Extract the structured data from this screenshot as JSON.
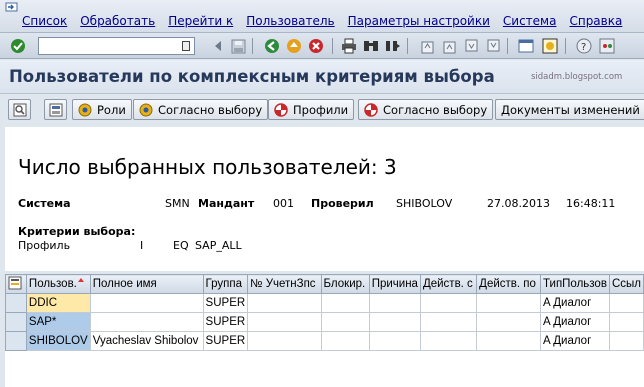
{
  "menu": {
    "items": [
      "Список",
      "Обработать",
      "Перейти к",
      "Пользователь",
      "Параметры настройки",
      "Система",
      "Справка"
    ]
  },
  "toolbar": {
    "command_value": "",
    "icons": [
      "enter-icon",
      "save-icon",
      "back-icon",
      "exit-icon",
      "cancel-icon",
      "print-icon",
      "find-icon",
      "find-next-icon",
      "first-page-icon",
      "prev-page-icon",
      "next-page-icon",
      "last-page-icon",
      "create-session-icon",
      "shortcut-icon",
      "help-icon",
      "customize-layout-icon"
    ]
  },
  "title": {
    "text": "Пользователи по комплексным критериям выбора",
    "watermark": "sidadm.blogspot.com"
  },
  "app_toolbar": {
    "roles_label": "Роли",
    "by_selection_label_1": "Согласно выбору",
    "profiles_label": "Профили",
    "by_selection_label_2": "Согласно выбору",
    "change_docs_label": "Документы изменений"
  },
  "report": {
    "heading": "Число выбранных пользователей: 3",
    "system_label": "Система",
    "system_value": "SMN",
    "client_label": "Мандант",
    "client_value": "001",
    "checked_by_label": "Проверил",
    "checked_by_value": "SHIBOLOV",
    "date": "27.08.2013",
    "time": "16:48:11",
    "criteria_label": "Критерии выбора:",
    "criteria": {
      "field": "Профиль",
      "sign": "I",
      "option": "EQ",
      "value": "SAP_ALL"
    }
  },
  "grid": {
    "columns": [
      "Пользов.",
      "Полное имя",
      "Группа",
      "№ УчетнЗпс",
      "Блокир.",
      "Причина",
      "Действ. с",
      "Действ. по",
      "ТипПользов",
      "Ссыл"
    ],
    "rows": [
      [
        "DDIC",
        "",
        "SUPER",
        "",
        "",
        "",
        "",
        "",
        "A Диалог",
        ""
      ],
      [
        "SAP*",
        "",
        "SUPER",
        "",
        "",
        "",
        "",
        "",
        "A Диалог",
        ""
      ],
      [
        "SHIBOLOV",
        "Vyacheslav Shibolov",
        "SUPER",
        "",
        "",
        "",
        "",
        "",
        "A Диалог",
        ""
      ]
    ]
  },
  "colors": {
    "title_text": "#27395b",
    "menu_text": "#00008b",
    "key_cell": "#aecbea",
    "focus_cell": "#ffe9a8"
  }
}
